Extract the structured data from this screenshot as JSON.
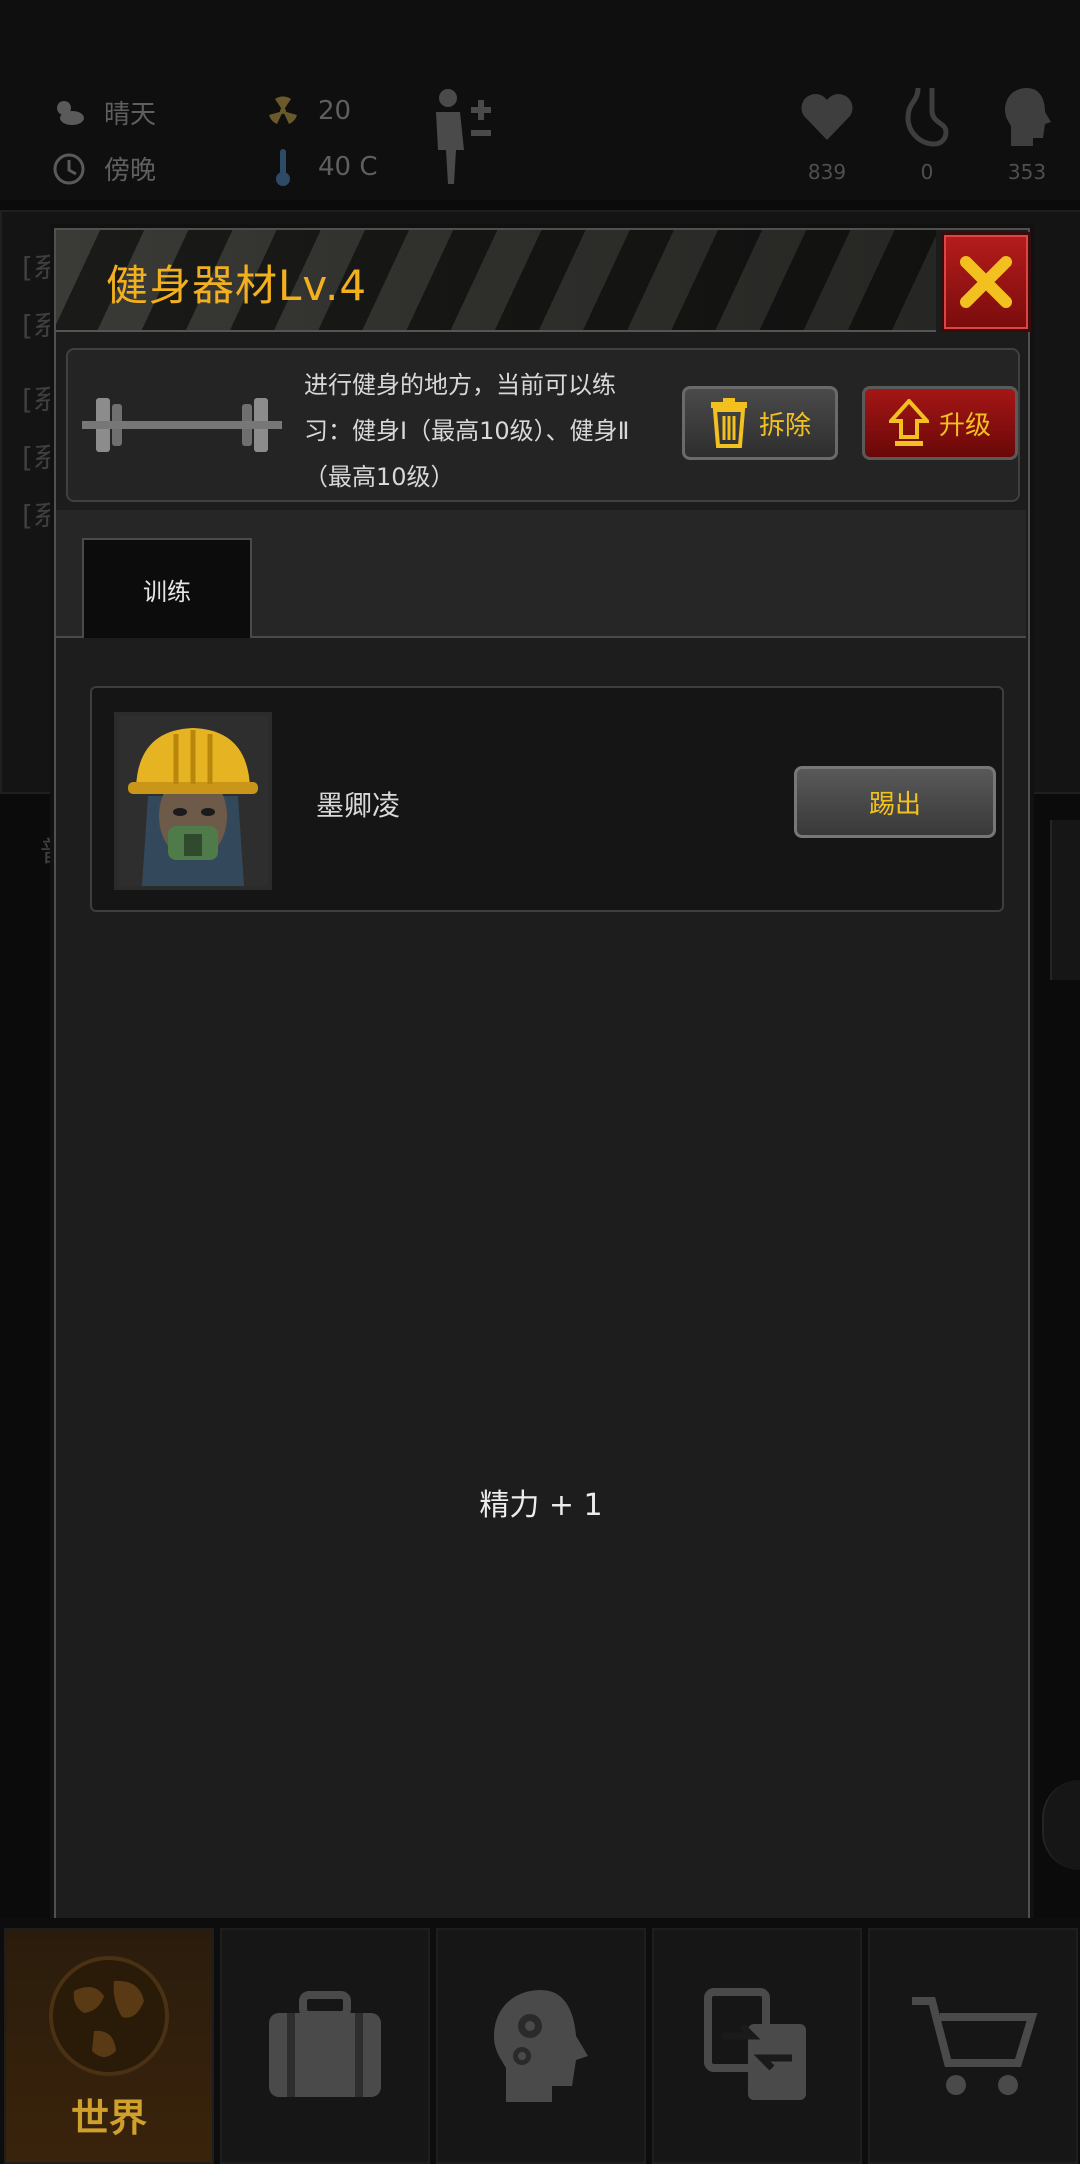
{
  "status": {
    "weather": "晴天",
    "time_of_day": "傍晚",
    "radiation": "20",
    "temperature": "40 C",
    "health": "839",
    "hunger": "0",
    "mind": "353"
  },
  "background": {
    "log_lines": [
      "[系",
      "[系",
      "[系",
      "[系",
      "[系"
    ],
    "side_label": "普"
  },
  "modal": {
    "title": "健身器材Lv.4",
    "description": "进行健身的地方，当前可以练习：健身Ⅰ（最高10级）、健身Ⅱ（最高10级）",
    "dismantle_label": "拆除",
    "upgrade_label": "升级",
    "tabs": [
      {
        "label": "训练"
      }
    ],
    "member": {
      "name": "墨卿凌",
      "kick_label": "踢出"
    },
    "effect": "精力 + 1"
  },
  "nav": {
    "items": [
      {
        "label": "世界",
        "icon": "globe-icon",
        "active": true
      },
      {
        "label": "",
        "icon": "suitcase-icon"
      },
      {
        "label": "",
        "icon": "head-gears-icon"
      },
      {
        "label": "",
        "icon": "exchange-icon"
      },
      {
        "label": "",
        "icon": "cart-icon"
      }
    ]
  },
  "colors": {
    "accent": "#f2b01e",
    "danger": "#a51616"
  }
}
